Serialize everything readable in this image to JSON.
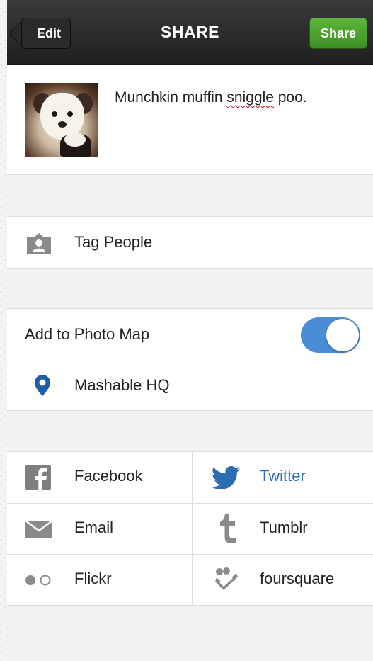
{
  "navbar": {
    "edit_label": "Edit",
    "title": "SHARE",
    "share_label": "Share"
  },
  "post": {
    "caption_before": "Munchkin muffin ",
    "caption_misspelled": "sniggle",
    "caption_after": " poo."
  },
  "tag_people": {
    "label": "Tag People",
    "icon": "tag-people-icon"
  },
  "photo_map": {
    "label": "Add to Photo Map",
    "enabled": true
  },
  "location": {
    "label": "Mashable HQ",
    "icon": "location-pin-icon"
  },
  "share_services": [
    {
      "label": "Facebook",
      "icon": "facebook-icon",
      "active": false
    },
    {
      "label": "Twitter",
      "icon": "twitter-icon",
      "active": true
    },
    {
      "label": "Email",
      "icon": "email-icon",
      "active": false
    },
    {
      "label": "Tumblr",
      "icon": "tumblr-icon",
      "active": false
    },
    {
      "label": "Flickr",
      "icon": "flickr-icon",
      "active": false
    },
    {
      "label": "foursquare",
      "icon": "foursquare-icon",
      "active": false
    }
  ],
  "colors": {
    "share_green": "#4aa12e",
    "toggle_blue": "#4a8dd6",
    "twitter_blue": "#2b6db3",
    "pin_blue": "#1f5fa6",
    "icon_gray": "#8a8a8a"
  }
}
